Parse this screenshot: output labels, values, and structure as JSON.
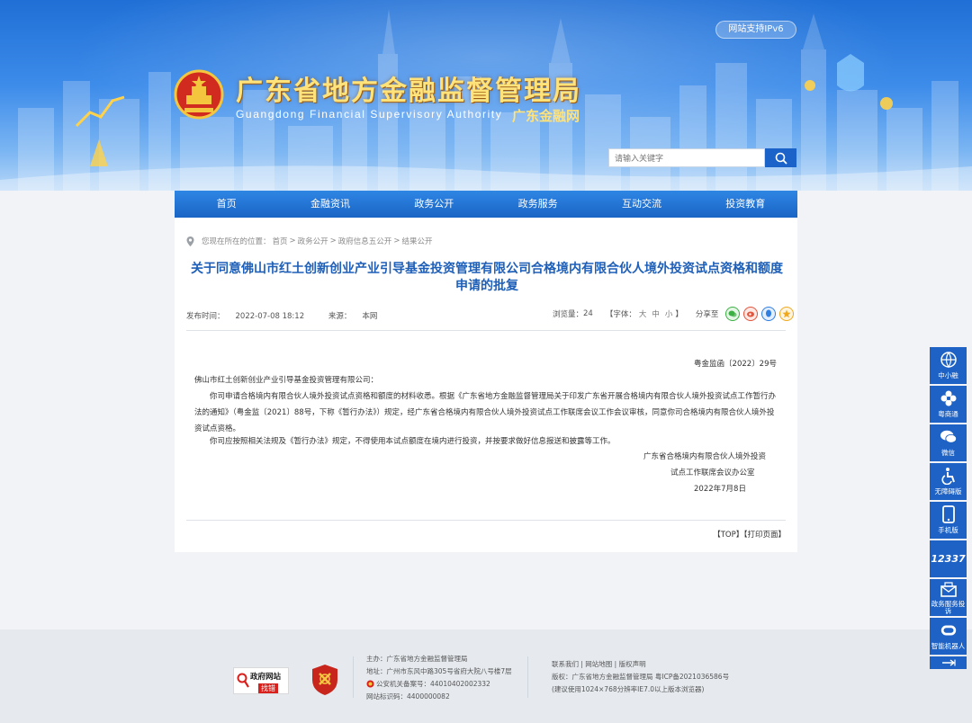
{
  "header": {
    "ipv6_badge": "网站支持IPv6",
    "site_title": "广东省地方金融监督管理局",
    "site_title_en": "Guangdong Financial Supervisory Authority",
    "site_short": "广东金融网",
    "search_placeholder": "请输入关键字"
  },
  "nav": [
    "首页",
    "金融资讯",
    "政务公开",
    "政务服务",
    "互动交流",
    "投资教育"
  ],
  "breadcrumb": {
    "prefix": "您现在所在的位置：",
    "items": [
      "首页",
      "政务公开",
      "政府信息五公开",
      "结果公开"
    ],
    "sep": ">"
  },
  "article": {
    "title": "关于同意佛山市红土创新创业产业引导基金投资管理有限公司合格境内有限合伙人境外投资试点资格和额度申请的批复",
    "publish_label": "发布时间：",
    "publish_time": "2022-07-08 18:12",
    "source_label": "来源：",
    "source": "本网",
    "views_label": "浏览量：",
    "views": "24",
    "font_label": "【字体：",
    "font_sizes": [
      "大",
      "中",
      "小"
    ],
    "font_close": "】",
    "share_label": "分享至"
  },
  "doc": {
    "number": "粤金监函〔2022〕29号",
    "addressee": "佛山市红土创新创业产业引导基金投资管理有限公司：",
    "p1": "你司申请合格境内有限合伙人境外投资试点资格和额度的材料收悉。根据《广东省地方金融监督管理局关于印发广东省开展合格境内有限合伙人境外投资试点工作暂行办法的通知》（粤金监〔2021〕88号，下称《暂行办法》）规定，经广东省合格境内有限合伙人境外投资试点工作联席会议工作会议审核，同意你司合格境内有限合伙人境外投资试点资格。",
    "p2": "你司应按照相关法规及《暂行办法》规定，不得使用本试点额度在境内进行投资，并按要求做好信息报送和披露等工作。",
    "sign1": "广东省合格境内有限合伙人境外投资",
    "sign2": "试点工作联席会议办公室",
    "date": "2022年7月8日"
  },
  "page_links": "【TOP】【打印页面】",
  "footer": {
    "badge1_top": "政府网站",
    "badge1_bottom": "找错",
    "host": "主办：广东省地方金融监督管理局",
    "address": "地址：广州市东风中路305号省府大院八号楼7层",
    "police": "公安机关备案号：44010402002332",
    "site_code": "网站标识码：4400000082",
    "links": "联系我们 | 网站地图 | 版权声明",
    "icp": "版权：广东省地方金融监督管理局 粤ICP备2021036586号",
    "advice": "(建议使用1024×768分辨率IE7.0以上版本浏览器)"
  },
  "floatbar": [
    {
      "label": "中小融",
      "icon": "globe-icon"
    },
    {
      "label": "粤商通",
      "icon": "flower-icon"
    },
    {
      "label": "微信",
      "icon": "wechat-icon"
    },
    {
      "label": "无障碍版",
      "icon": "accessibility-icon"
    },
    {
      "label": "手机版",
      "icon": "phone-icon"
    },
    {
      "label": "12337",
      "icon": "hotline-icon"
    },
    {
      "label": "政务服务投诉",
      "icon": "complaint-icon"
    },
    {
      "label": "智能机器人",
      "icon": "robot-icon"
    }
  ],
  "colors": {
    "nav_blue": "#1964c6",
    "title_blue": "#1e5fb8",
    "header_gold": "#ffe37a"
  }
}
